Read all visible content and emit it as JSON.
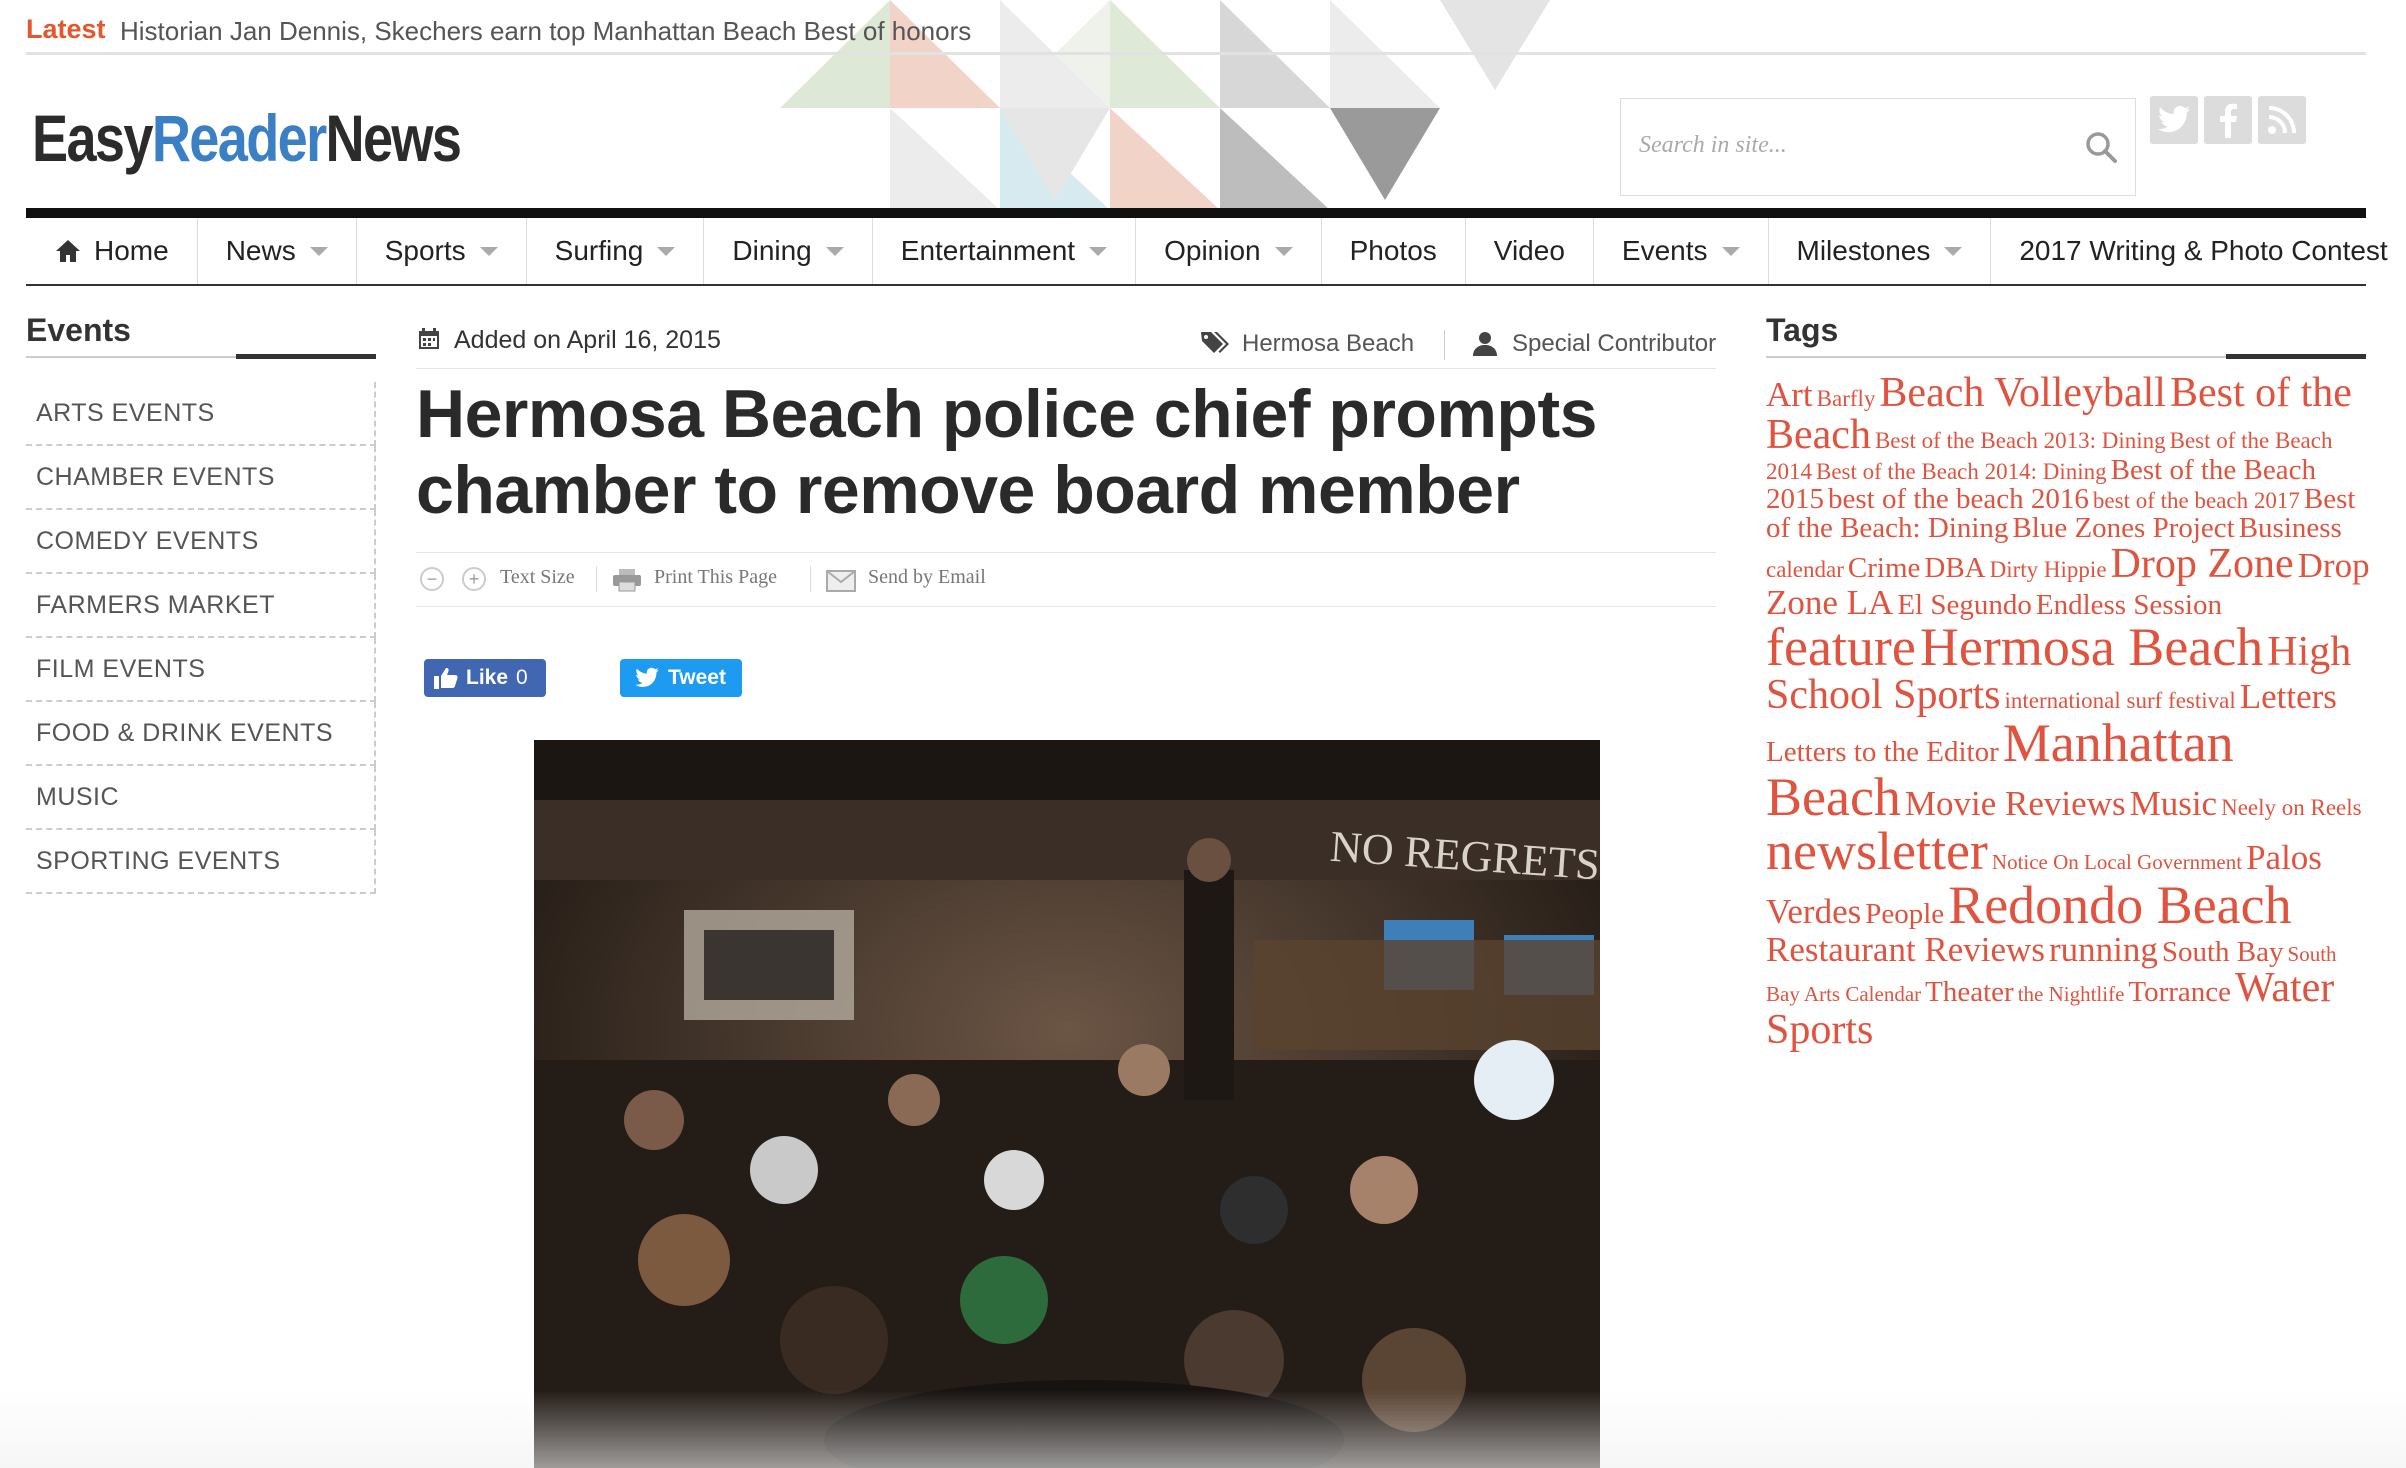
{
  "latest": {
    "label": "Latest",
    "headline": "Historian Jan Dennis, Skechers earn top Manhattan Beach Best of honors"
  },
  "logo": {
    "part1": "Easy",
    "part2": "Reader",
    "part3": "News"
  },
  "search": {
    "placeholder": "Search in site..."
  },
  "social": [
    "twitter-icon",
    "facebook-icon",
    "rss-icon"
  ],
  "nav": [
    {
      "label": "Home",
      "icon": "home-icon",
      "dropdown": false
    },
    {
      "label": "News",
      "dropdown": true
    },
    {
      "label": "Sports",
      "dropdown": true
    },
    {
      "label": "Surfing",
      "dropdown": true
    },
    {
      "label": "Dining",
      "dropdown": true
    },
    {
      "label": "Entertainment",
      "dropdown": true
    },
    {
      "label": "Opinion",
      "dropdown": true
    },
    {
      "label": "Photos",
      "dropdown": false
    },
    {
      "label": "Video",
      "dropdown": false
    },
    {
      "label": "Events",
      "dropdown": true
    },
    {
      "label": "Milestones",
      "dropdown": true
    },
    {
      "label": "2017 Writing & Photo Contest",
      "dropdown": false
    }
  ],
  "sidebar": {
    "title": "Events",
    "items": [
      "ARTS EVENTS",
      "CHAMBER EVENTS",
      "COMEDY EVENTS",
      "FARMERS MARKET",
      "FILM EVENTS",
      "FOOD & DRINK EVENTS",
      "MUSIC",
      "SPORTING EVENTS"
    ]
  },
  "article": {
    "date": "Added on April 16, 2015",
    "category": "Hermosa Beach",
    "author": "Special Contributor",
    "headline": "Hermosa Beach police chief prompts chamber to remove board member",
    "tools": {
      "minus": "−",
      "plus": "+",
      "text_size": "Text Size",
      "print": "Print This Page",
      "email": "Send by Email"
    },
    "share": {
      "like": "Like",
      "like_count": "0",
      "tweet": "Tweet"
    },
    "photo_sign": "NO REGRETS"
  },
  "tags": {
    "title": "Tags",
    "items": [
      {
        "label": "Art",
        "size": 3
      },
      {
        "label": "Barfly",
        "size": 1
      },
      {
        "label": "Beach Volleyball",
        "size": 4
      },
      {
        "label": "Best of the Beach",
        "size": 4
      },
      {
        "label": "Best of the Beach 2013: Dining",
        "size": 1
      },
      {
        "label": "Best of the Beach 2014",
        "size": 1
      },
      {
        "label": "Best of the Beach 2014: Dining",
        "size": 1
      },
      {
        "label": "Best of the Beach 2015",
        "size": 2
      },
      {
        "label": "best of the beach 2016",
        "size": 2
      },
      {
        "label": "best of the beach 2017",
        "size": 1
      },
      {
        "label": "Best of the Beach: Dining",
        "size": 2
      },
      {
        "label": "Blue Zones Project",
        "size": 2
      },
      {
        "label": "Business",
        "size": 2
      },
      {
        "label": "calendar",
        "size": 1
      },
      {
        "label": "Crime",
        "size": 2
      },
      {
        "label": "DBA",
        "size": 2
      },
      {
        "label": "Dirty Hippie",
        "size": 1
      },
      {
        "label": "Drop Zone",
        "size": 4
      },
      {
        "label": "Drop Zone LA",
        "size": 3
      },
      {
        "label": "El Segundo",
        "size": 2
      },
      {
        "label": "Endless Session",
        "size": 2
      },
      {
        "label": "feature",
        "size": 5
      },
      {
        "label": "Hermosa Beach",
        "size": 5
      },
      {
        "label": "High School Sports",
        "size": 4
      },
      {
        "label": "international surf festival",
        "size": 1
      },
      {
        "label": "Letters",
        "size": 3
      },
      {
        "label": "Letters to the Editor",
        "size": 2
      },
      {
        "label": "Manhattan Beach",
        "size": 5
      },
      {
        "label": "Movie Reviews",
        "size": 3
      },
      {
        "label": "Music",
        "size": 3
      },
      {
        "label": "Neely on Reels",
        "size": 1
      },
      {
        "label": "newsletter",
        "size": 5
      },
      {
        "label": "Notice On Local Government",
        "size": 0
      },
      {
        "label": "Palos Verdes",
        "size": 3
      },
      {
        "label": "People",
        "size": 2
      },
      {
        "label": "Redondo Beach",
        "size": 5
      },
      {
        "label": "Restaurant Reviews",
        "size": 3
      },
      {
        "label": "running",
        "size": 3
      },
      {
        "label": "South Bay",
        "size": 2
      },
      {
        "label": "South Bay Arts Calendar",
        "size": 0
      },
      {
        "label": "Theater",
        "size": 2
      },
      {
        "label": "the Nightlife",
        "size": 0
      },
      {
        "label": "Torrance",
        "size": 2
      },
      {
        "label": "Water Sports",
        "size": 4
      }
    ]
  }
}
